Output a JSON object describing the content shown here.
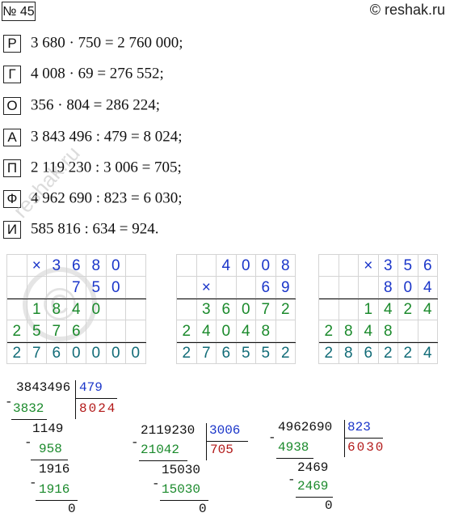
{
  "header": {
    "number_label": "№ 45",
    "site": "© reshak.ru"
  },
  "equations": [
    {
      "letter": "Р",
      "text": "3 680 · 750 = 2 760 000;"
    },
    {
      "letter": "Г",
      "text": "4 008 · 69 = 276 552;"
    },
    {
      "letter": "О",
      "text": "356 · 804 = 286 224;"
    },
    {
      "letter": "А",
      "text": "3 843 496 : 479 = 8 024;"
    },
    {
      "letter": "П",
      "text": "2 119 230 : 3 006 = 705;"
    },
    {
      "letter": "Ф",
      "text": "4 962 690 : 823 = 6 030;"
    },
    {
      "letter": "И",
      "text": "585 816 : 634 = 924."
    }
  ],
  "watermark": "reshak.ru",
  "mult_grids": [
    {
      "rows": [
        [
          "",
          "×",
          "3",
          "6",
          "8",
          "0",
          ""
        ],
        [
          "",
          "",
          "",
          "7",
          "5",
          "0",
          ""
        ],
        [
          "",
          "1",
          "8",
          "4",
          "0",
          "",
          ""
        ],
        [
          "2",
          "5",
          "7",
          "6",
          "",
          "",
          ""
        ],
        [
          "2",
          "7",
          "6",
          "0",
          "0",
          "0",
          "0"
        ]
      ]
    },
    {
      "rows": [
        [
          "",
          "",
          "4",
          "0",
          "0",
          "8"
        ],
        [
          "",
          "×",
          "",
          "",
          "6",
          "9"
        ],
        [
          "",
          "3",
          "6",
          "0",
          "7",
          "2"
        ],
        [
          "2",
          "4",
          "0",
          "4",
          "8",
          ""
        ],
        [
          "2",
          "7",
          "6",
          "5",
          "5",
          "2"
        ]
      ]
    },
    {
      "rows": [
        [
          "",
          "",
          "×",
          "3",
          "5",
          "6"
        ],
        [
          "",
          "",
          "",
          "8",
          "0",
          "4"
        ],
        [
          "",
          "",
          "1",
          "4",
          "2",
          "4"
        ],
        [
          "2",
          "8",
          "4",
          "8",
          "",
          ""
        ],
        [
          "2",
          "8",
          "6",
          "2",
          "2",
          "4"
        ]
      ]
    }
  ],
  "long_divisions": [
    {
      "dividend": "3843496",
      "divisor": "479",
      "quotient": "8024",
      "steps": [
        {
          "sub": "3832",
          "rem": "1149"
        },
        {
          "sub": "958",
          "rem": "1916"
        },
        {
          "sub": "1916",
          "rem": "0"
        }
      ]
    },
    {
      "dividend": "2119230",
      "divisor": "3006",
      "quotient": "705",
      "steps": [
        {
          "sub": "21042",
          "rem": "15030"
        },
        {
          "sub": "15030",
          "rem": "0"
        }
      ]
    },
    {
      "dividend": "4962690",
      "divisor": "823",
      "quotient": "6030",
      "steps": [
        {
          "sub": "4938",
          "rem": "2469"
        },
        {
          "sub": "2469",
          "rem": "0"
        }
      ]
    }
  ],
  "minus_sign": "-"
}
